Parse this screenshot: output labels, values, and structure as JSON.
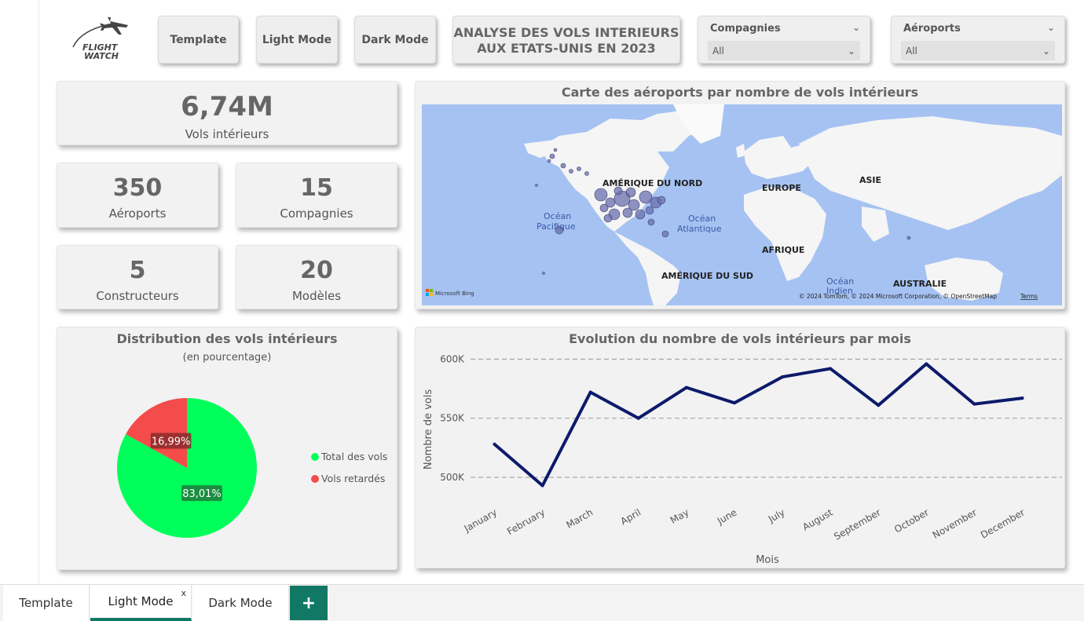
{
  "header": {
    "logo_line1": "FLIGHT",
    "logo_line2": "WATCH",
    "buttons": [
      "Template",
      "Light Mode",
      "Dark Mode"
    ],
    "title_line1": "ANALYSE DES VOLS INTERIEURS",
    "title_line2": "AUX ETATS-UNIS EN 2023"
  },
  "slicers": [
    {
      "label": "Compagnies",
      "value": "All"
    },
    {
      "label": "Aéroports",
      "value": "All"
    }
  ],
  "kpis": {
    "flights": {
      "value": "6,74M",
      "label": "Vols intérieurs"
    },
    "airports": {
      "value": "350",
      "label": "Aéroports"
    },
    "airlines": {
      "value": "15",
      "label": "Compagnies"
    },
    "manufacturers": {
      "value": "5",
      "label": "Constructeurs"
    },
    "models": {
      "value": "20",
      "label": "Modèles"
    }
  },
  "map": {
    "title": "Carte des aéroports par nombre de vols intérieurs",
    "labels": {
      "north_america": "AMÉRIQUE DU NORD",
      "europe": "EUROPE",
      "asia": "ASIE",
      "africa": "AFRIQUE",
      "south_america": "AMÉRIQUE DU SUD",
      "australia": "AUSTRALIE",
      "pacific_1": "Océan",
      "pacific_2": "Pacifique",
      "atlantic_1": "Océan",
      "atlantic_2": "Atlantique",
      "indian_1": "Océan",
      "indian_2": "Indien"
    },
    "bing": "Microsoft Bing",
    "copyright": "© 2024 TomTom, © 2024 Microsoft Corporation, © OpenStreetMap",
    "terms": "Terms",
    "colors": {
      "water": "#a5c2f2",
      "land": "#f5f5f5",
      "bubble": "#6a6fad"
    }
  },
  "pie": {
    "title": "Distribution des vols intérieurs",
    "subtitle": "(en pourcentage)",
    "legend": [
      "Total des vols",
      "Vols retardés"
    ],
    "labels": [
      "83,01%",
      "16,99%"
    ],
    "colors": [
      "#00ff5a",
      "#f44b4b"
    ]
  },
  "line": {
    "title": "Evolution du nombre de vols intérieurs par mois",
    "xlabel": "Mois",
    "ylabel": "Nombre de vols",
    "ytick_labels": [
      "600K",
      "550K",
      "500K"
    ],
    "color": "#0d1a6b"
  },
  "chart_data": [
    {
      "type": "pie",
      "title": "Distribution des vols intérieurs",
      "subtitle": "(en pourcentage)",
      "categories": [
        "Total des vols",
        "Vols retardés"
      ],
      "values": [
        83.01,
        16.99
      ],
      "legend_position": "right"
    },
    {
      "type": "line",
      "title": "Evolution du nombre de vols intérieurs par mois",
      "xlabel": "Mois",
      "ylabel": "Nombre de vols",
      "categories": [
        "January",
        "February",
        "March",
        "April",
        "May",
        "June",
        "July",
        "August",
        "September",
        "October",
        "November",
        "December"
      ],
      "values": [
        528000,
        493000,
        572000,
        550000,
        576000,
        563000,
        585000,
        592000,
        561000,
        596000,
        562000,
        567000
      ],
      "ylim": [
        490000,
        605000
      ],
      "yticks": [
        500000,
        550000,
        600000
      ],
      "grid": true
    }
  ],
  "tabs": [
    {
      "label": "Template"
    },
    {
      "label": "Light Mode",
      "close": "x"
    },
    {
      "label": "Dark Mode"
    }
  ],
  "tab_add": "+"
}
